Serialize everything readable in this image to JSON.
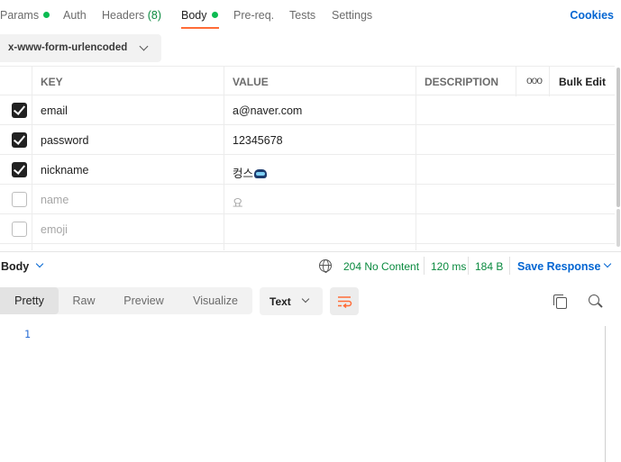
{
  "tabs": {
    "params": "Params",
    "auth": "Auth",
    "headers": "Headers",
    "headers_count": "(8)",
    "body": "Body",
    "prereq": "Pre-req.",
    "tests": "Tests",
    "settings": "Settings",
    "cookies": "Cookies"
  },
  "body_type": "x-www-form-urlencoded",
  "table": {
    "headers": {
      "key": "KEY",
      "value": "VALUE",
      "description": "DESCRIPTION",
      "more": "ooo",
      "bulk_edit": "Bulk Edit"
    },
    "rows": [
      {
        "key": "email",
        "value": "a@naver.com",
        "checked": true
      },
      {
        "key": "password",
        "value": "12345678",
        "checked": true
      },
      {
        "key": "nickname",
        "value": "컹스",
        "checked": true
      },
      {
        "key": "name",
        "value": "요",
        "checked": false
      },
      {
        "key": "emoji",
        "value": "",
        "checked": false
      }
    ]
  },
  "response": {
    "section": "Body",
    "status": "204 No Content",
    "time": "120 ms",
    "size": "184 B",
    "save": "Save Response"
  },
  "view_tabs": {
    "pretty": "Pretty",
    "raw": "Raw",
    "preview": "Preview",
    "visualize": "Visualize"
  },
  "format": "Text",
  "editor": {
    "line1": "1"
  },
  "colors": {
    "accent": "#ff6c37",
    "link": "#0265d2",
    "success": "#0cbb52"
  }
}
